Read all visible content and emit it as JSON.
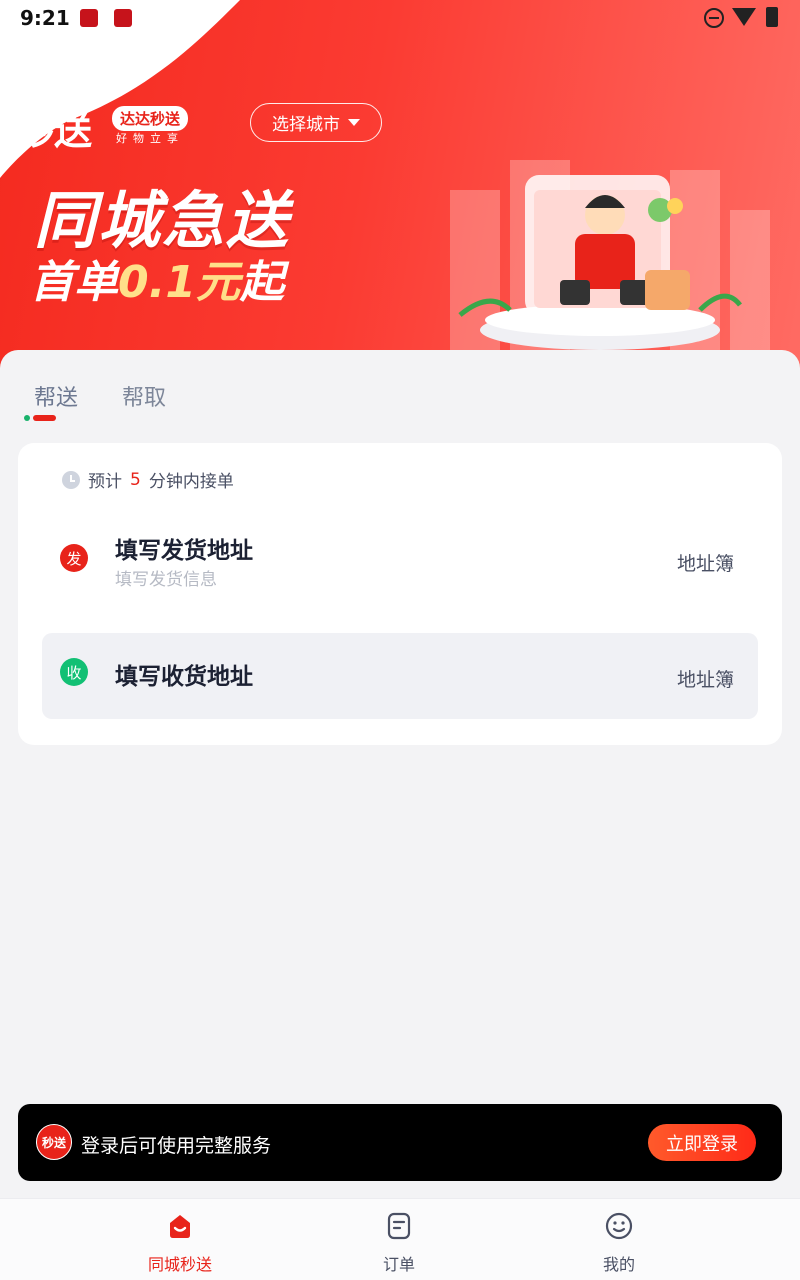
{
  "status_bar": {
    "time": "9:21"
  },
  "header": {
    "logo_text": "秒送",
    "logo_badge": "达达秒送",
    "logo_slogan": "好物立享",
    "city_button": "选择城市"
  },
  "hero": {
    "title": "同城急送",
    "subtitle_prefix": "首单",
    "subtitle_highlight": "0.1元",
    "subtitle_suffix": "起"
  },
  "tabs": [
    {
      "label": "帮送",
      "active": true
    },
    {
      "label": "帮取",
      "active": false
    }
  ],
  "card": {
    "eta_prefix": "预计",
    "eta_minutes": "5",
    "eta_suffix": "分钟内接单",
    "send": {
      "badge": "发",
      "title": "填写发货地址",
      "hint": "填写发货信息",
      "address_book": "地址簿"
    },
    "receive": {
      "badge": "收",
      "title": "填写收货地址",
      "address_book": "地址簿"
    }
  },
  "login_bar": {
    "logo": "秒送",
    "text": "登录后可使用完整服务",
    "button": "立即登录"
  },
  "bottom_nav": [
    {
      "label": "同城秒送",
      "icon": "home-bag-icon",
      "active": true
    },
    {
      "label": "订单",
      "icon": "order-list-icon",
      "active": false
    },
    {
      "label": "我的",
      "icon": "smiley-profile-icon",
      "active": false
    }
  ],
  "colors": {
    "brand_red": "#e8231a",
    "receive_green": "#12c074",
    "login_button_orange": "#ff4a22"
  }
}
